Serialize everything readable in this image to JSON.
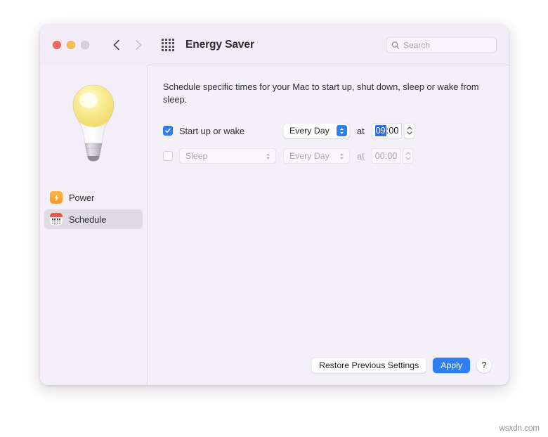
{
  "window": {
    "title": "Energy Saver",
    "traffic_lights": [
      "close",
      "minimize",
      "maximize"
    ],
    "nav": {
      "back": "back-arrow",
      "forward": "forward-arrow",
      "grid": "all-preferences-grid"
    }
  },
  "search": {
    "placeholder": "Search",
    "value": "",
    "icon": "search-icon"
  },
  "sidebar": {
    "illustration": "light-bulb-illustration",
    "items": [
      {
        "label": "Power",
        "icon": "power-bolt-icon",
        "selected": false
      },
      {
        "label": "Schedule",
        "icon": "calendar-icon",
        "selected": true
      }
    ]
  },
  "main": {
    "description": "Schedule specific times for your Mac to start up, shut down, sleep or wake from sleep.",
    "rows": [
      {
        "checked": true,
        "enabled": true,
        "label": "Start up or wake",
        "is_popup_label": false,
        "day": "Every Day",
        "at": "at",
        "time_hour": "09",
        "time_rest": ":00",
        "hour_selected": true
      },
      {
        "checked": false,
        "enabled": false,
        "label": "Sleep",
        "is_popup_label": true,
        "day": "Every Day",
        "at": "at",
        "time_hour": "00",
        "time_rest": ":00",
        "hour_selected": false
      }
    ]
  },
  "footer": {
    "restore_label": "Restore Previous Settings",
    "apply_label": "Apply",
    "help_label": "?"
  },
  "watermark": "wsxdn.com",
  "colors": {
    "accent": "#2f7ff0",
    "window_bg": "#f2eef6",
    "sidebar_bg": "#f3eef7",
    "main_bg": "#f4f0f7",
    "close": "#ec6a5f",
    "minimize": "#f4bd4f",
    "maximize": "#d4d0d6",
    "power_icon": "#f79a22",
    "calendar_icon": "#e2584e"
  }
}
